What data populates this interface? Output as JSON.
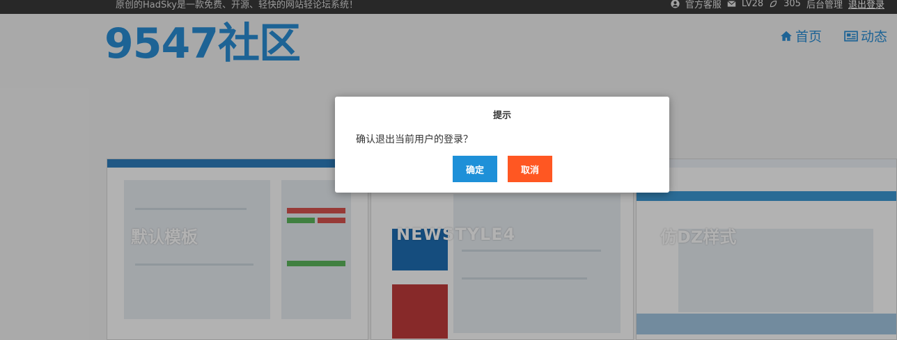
{
  "topbar": {
    "slogan": "原创的HadSky是一款免费、开源、轻快的网站轻论坛系统！",
    "items": [
      {
        "icon": "user-icon",
        "label": "官方客服"
      },
      {
        "icon": "mail-icon",
        "label": "LV28"
      },
      {
        "icon": "leaf-icon",
        "label": "305"
      },
      {
        "icon": "",
        "label": "后台管理"
      }
    ],
    "logout": "退出登录"
  },
  "header": {
    "logo": "9547社区",
    "nav": [
      {
        "icon": "home-icon",
        "label": "首页"
      },
      {
        "icon": "newspaper-icon",
        "label": "动态"
      }
    ]
  },
  "templates": [
    {
      "label": "默认模板"
    },
    {
      "label": "NEWSTYLE4"
    },
    {
      "label": "仿DZ样式"
    }
  ],
  "dialog": {
    "title": "提示",
    "message": "确认退出当前用户的登录？",
    "confirm": "确定",
    "cancel": "取消"
  },
  "colors": {
    "brand": "#2a8fd6",
    "confirm": "#1e90d8",
    "cancel": "#ff5722",
    "topbar": "#3a3a3a"
  }
}
